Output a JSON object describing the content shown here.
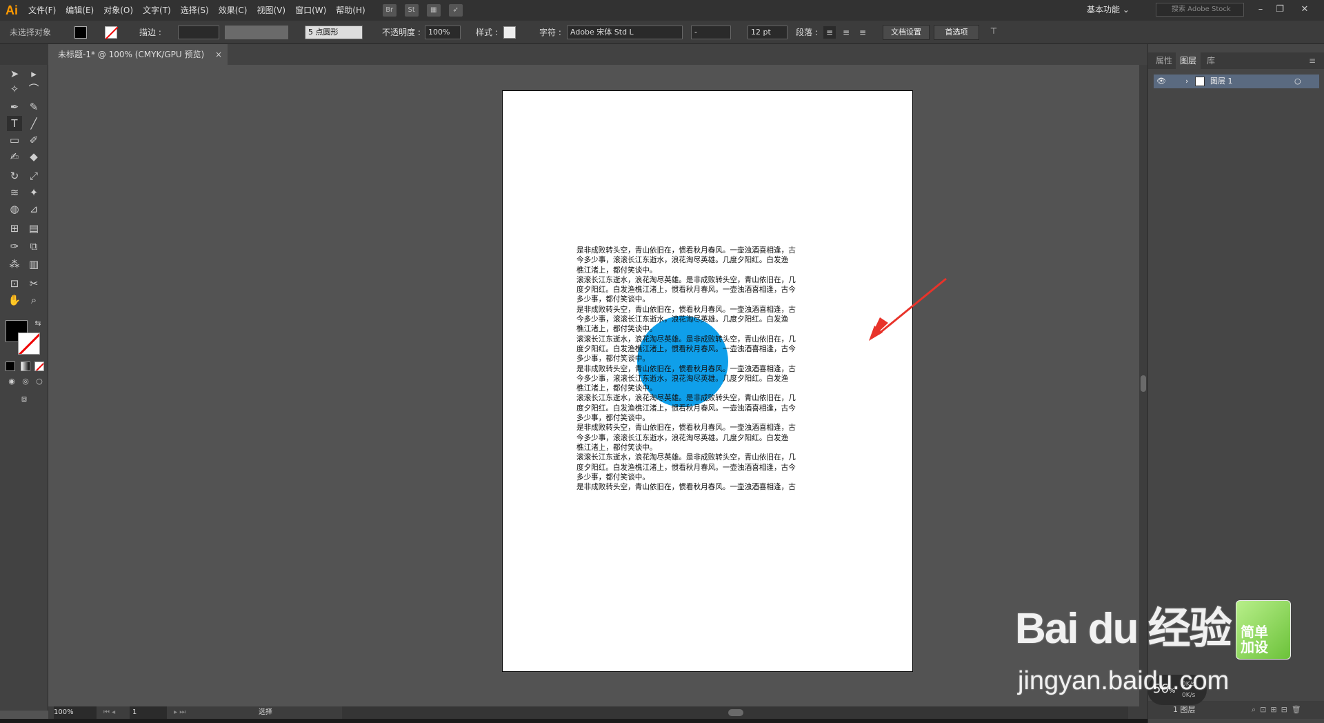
{
  "app": {
    "logo": "Ai"
  },
  "menu": [
    "文件(F)",
    "编辑(E)",
    "对象(O)",
    "文字(T)",
    "选择(S)",
    "效果(C)",
    "视图(V)",
    "窗口(W)",
    "帮助(H)"
  ],
  "menubar_icons": [
    "Br",
    "St"
  ],
  "workspace": "基本功能",
  "stock_search_placeholder": "搜索 Adobe Stock",
  "control": {
    "no_selection": "未选择对象",
    "stroke_label": "描边 :",
    "brush": "5 点圆形",
    "opacity_label": "不透明度 :",
    "opacity_value": "100%",
    "style_label": "样式 :",
    "char_label": "字符 :",
    "font": "Adobe 宋体 Std L",
    "font_style": "-",
    "font_size": "12 pt",
    "para_label": "段落 :",
    "doc_setup": "文档设置",
    "prefs": "首选项"
  },
  "document_tab": {
    "title": "未标题-1* @ 100% (CMYK/GPU 预览)",
    "close": "×"
  },
  "artboard_text": [
    "是非成败转头空，青山依旧在，惯看秋月春风。一壶浊酒喜相逢，古",
    "今多少事，滚滚长江东逝水，浪花淘尽英雄。几度夕阳红。白发渔",
    "樵江渚上，都付笑谈中。",
    "滚滚长江东逝水，浪花淘尽英雄。是非成败转头空，青山依旧在，几",
    "度夕阳红。白发渔樵江渚上，惯看秋月春风。一壶浊酒喜相逢，古今",
    "多少事，都付笑谈中。",
    "是非成败转头空，青山依旧在，惯看秋月春风。一壶浊酒喜相逢，古",
    "今多少事，滚滚长江东逝水，浪花淘尽英雄。几度夕阳红。白发渔",
    "樵江渚上，都付笑谈中。",
    "滚滚长江东逝水，浪花淘尽英雄。是非成败转头空，青山依旧在，几",
    "度夕阳红。白发渔樵江渚上，惯看秋月春风。一壶浊酒喜相逢，古今",
    "多少事，都付笑谈中。",
    "是非成败转头空，青山依旧在，惯看秋月春风。一壶浊酒喜相逢，古",
    "今多少事，滚滚长江东逝水，浪花淘尽英雄。几度夕阳红。白发渔",
    "樵江渚上，都付笑谈中。",
    "滚滚长江东逝水，浪花淘尽英雄。是非成败转头空，青山依旧在，几",
    "度夕阳红。白发渔樵江渚上，惯看秋月春风。一壶浊酒喜相逢，古今",
    "多少事，都付笑谈中。",
    "是非成败转头空，青山依旧在，惯看秋月春风。一壶浊酒喜相逢，古",
    "今多少事，滚滚长江东逝水，浪花淘尽英雄。几度夕阳红。白发渔",
    "樵江渚上，都付笑谈中。",
    "滚滚长江东逝水，浪花淘尽英雄。是非成败转头空，青山依旧在，几",
    "度夕阳红。白发渔樵江渚上，惯看秋月春风。一壶浊酒喜相逢，古今",
    "多少事，都付笑谈中。",
    "是非成败转头空，青山依旧在，惯看秋月春风。一壶浊酒喜相逢，古"
  ],
  "colors": {
    "circle": "#0f9fea",
    "arrow": "#e8332a"
  },
  "status": {
    "zoom": "100%",
    "page": "1",
    "tool": "选择"
  },
  "panel": {
    "tabs": [
      "属性",
      "图层",
      "库"
    ],
    "layer_name": "图层 1",
    "footer": "1 图层"
  },
  "net": {
    "percent": "56",
    "unit": "%",
    "speed": "0K/s"
  },
  "watermark": {
    "logo": "Bai du 经验",
    "url": "jingyan.baidu.com",
    "badge": "简单\n加设"
  }
}
